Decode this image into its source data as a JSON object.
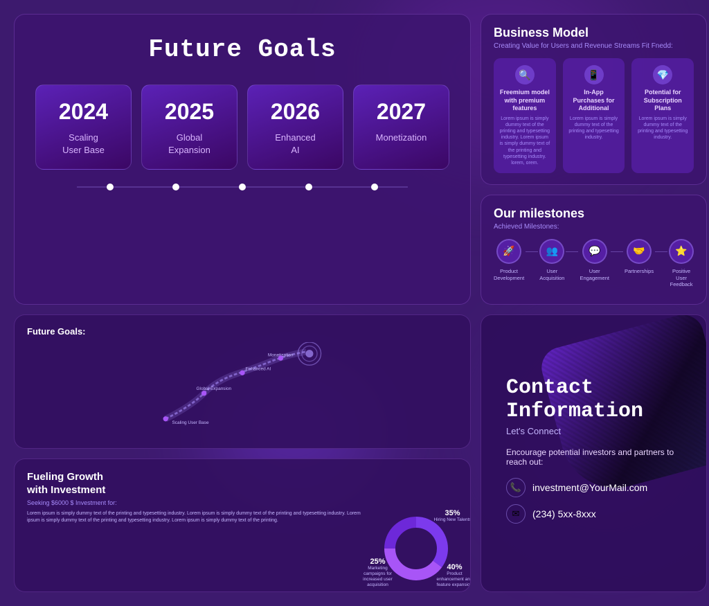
{
  "page": {
    "bg_color": "#3d1a6e"
  },
  "future_goals": {
    "title": "Future Goals",
    "years": [
      {
        "year": "2024",
        "label": "Scaling User Base"
      },
      {
        "year": "2025",
        "label": "Global Expansion"
      },
      {
        "year": "2026",
        "label": "Enhanced AI"
      },
      {
        "year": "2027",
        "label": "Monetization"
      }
    ],
    "dots": 5
  },
  "business_model": {
    "title": "Business Model",
    "subtitle": "Creating Value for Users and Revenue Streams Fit Fnedd:",
    "items": [
      {
        "icon": "🔍",
        "title": "Freemium model with premium features",
        "text": "Lorem ipsum is simply dummy text of the printing and typesetting industry."
      },
      {
        "icon": "📱",
        "title": "In-App Purchases for Additional",
        "text": "Lorem ipsum is simply dummy text of the printing and typesetting industry."
      },
      {
        "icon": "💎",
        "title": "Potential for Subscription Plans",
        "text": "Lorem ipsum is simply dummy text of the printing and typesetting industry."
      }
    ]
  },
  "milestones": {
    "title": "Our milestones",
    "subtitle": "Achieved Milestones:",
    "items": [
      {
        "icon": "🚀",
        "label": "Product Development"
      },
      {
        "icon": "👥",
        "label": "User Acquisition"
      },
      {
        "icon": "💬",
        "label": "User Engagement"
      },
      {
        "icon": "🤝",
        "label": "Partnerships"
      },
      {
        "icon": "⭐",
        "label": "Positive User Feedback"
      }
    ]
  },
  "future_goals_mini": {
    "title": "Future Goals:",
    "road_labels": [
      "Scaling User Base",
      "Global Expansion",
      "Enhanced AI",
      "Monetization"
    ]
  },
  "fueling_growth": {
    "title": "Fueling Growth with Investment",
    "subtitle": "Seeking $6000 $ Investment for:",
    "paragraphs": [
      "Lorem ipsum is simply dummy text of the printing and typesetting industry. Lorem ipsum is simply dummy text of the printing and typesetting industry.",
      "Lorem ipsum is simply dummy text of the printing and typesetting industry."
    ],
    "chart_segments": [
      {
        "pct": "35%",
        "label": "Hiring New Talents",
        "color": "#7c3aed"
      },
      {
        "pct": "40%",
        "label": "Product enhancement and feature expansion",
        "color": "#a855f7"
      },
      {
        "pct": "25%",
        "label": "Marketing campaigns for increased user acquisition",
        "color": "#6d28d9"
      }
    ]
  },
  "contact": {
    "title": "Contact Information",
    "lets_connect": "Let's Connect",
    "encourage": "Encourage potential investors and partners to reach out:",
    "email_icon": "📞",
    "email": "investment@YourMail.com",
    "phone_icon": "✉",
    "phone": "(234) 5xx-8xxx"
  }
}
